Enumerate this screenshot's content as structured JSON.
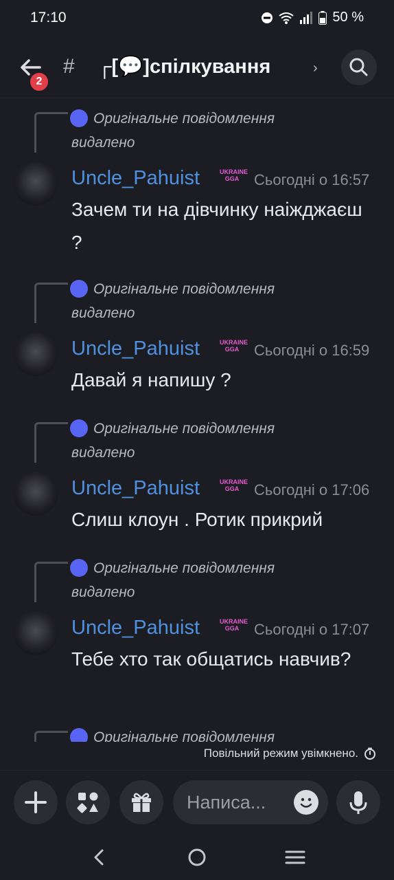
{
  "status_bar": {
    "time": "17:10",
    "battery": "50 %"
  },
  "header": {
    "back_badge": "2",
    "channel_name": "┌[💬]спілкування"
  },
  "reply_text": "Оригінальне повідомлення видалено",
  "messages": [
    {
      "username": "Uncle_Pahuist",
      "tag": "UKRAINE GGA",
      "timestamp": "Сьогодні о 16:57",
      "text": "Зачем ти на дівчинку наіжджаєш ?"
    },
    {
      "username": "Uncle_Pahuist",
      "tag": "UKRAINE GGA",
      "timestamp": "Сьогодні о 16:59",
      "text": "Давай я напишу  ?"
    },
    {
      "username": "Uncle_Pahuist",
      "tag": "UKRAINE GGA",
      "timestamp": "Сьогодні о 17:06",
      "text": "Слиш клоун . Ротик прикрий"
    },
    {
      "username": "Uncle_Pahuist",
      "tag": "UKRAINE GGA",
      "timestamp": "Сьогодні о 17:07",
      "text": "Тебе хто так общатись навчив?"
    }
  ],
  "slow_mode": "Повільний режим увімкнено.",
  "composer": {
    "placeholder": "Написа..."
  },
  "icons": {
    "back": "back-arrow-icon",
    "search": "search-icon",
    "plus": "plus-icon",
    "apps": "apps-icon",
    "gift": "gift-icon",
    "emoji": "emoji-icon",
    "mic": "microphone-icon"
  },
  "colors": {
    "background": "#1c1d22",
    "username": "#4f91e0",
    "accent": "#5865f2",
    "badge": "#e23e4a"
  }
}
